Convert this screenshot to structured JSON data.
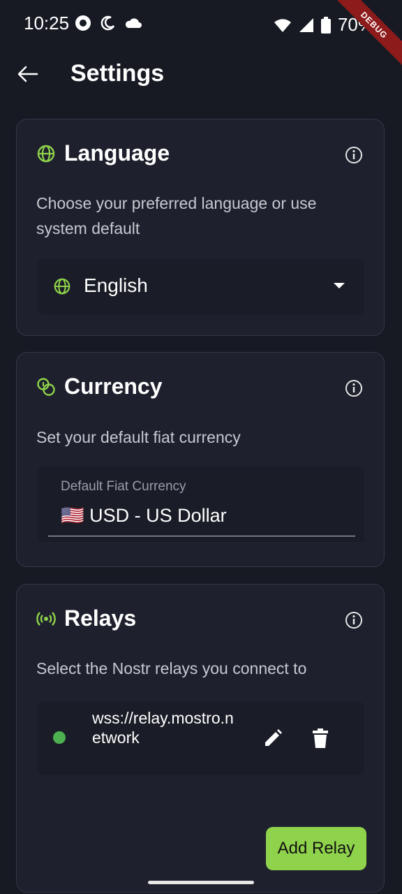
{
  "status_bar": {
    "time": "10:25",
    "battery": "70%",
    "debug_banner": "DEBUG"
  },
  "app_bar": {
    "title": "Settings"
  },
  "language_card": {
    "title": "Language",
    "description": "Choose your preferred language or use system default",
    "selected_language": "English"
  },
  "currency_card": {
    "title": "Currency",
    "description": "Set your default fiat currency",
    "field_label": "Default Fiat Currency",
    "field_flag": "🇺🇸",
    "field_value": "USD - US Dollar"
  },
  "relays_card": {
    "title": "Relays",
    "description": "Select the Nostr relays you connect to",
    "relays": [
      {
        "url": "wss://relay.mostro.network",
        "status": "connected"
      }
    ],
    "add_button": "Add Relay"
  },
  "colors": {
    "background": "#171a23",
    "card": "#1e212d",
    "accent_green": "#8fd24b",
    "status_connected": "#4caf50"
  }
}
